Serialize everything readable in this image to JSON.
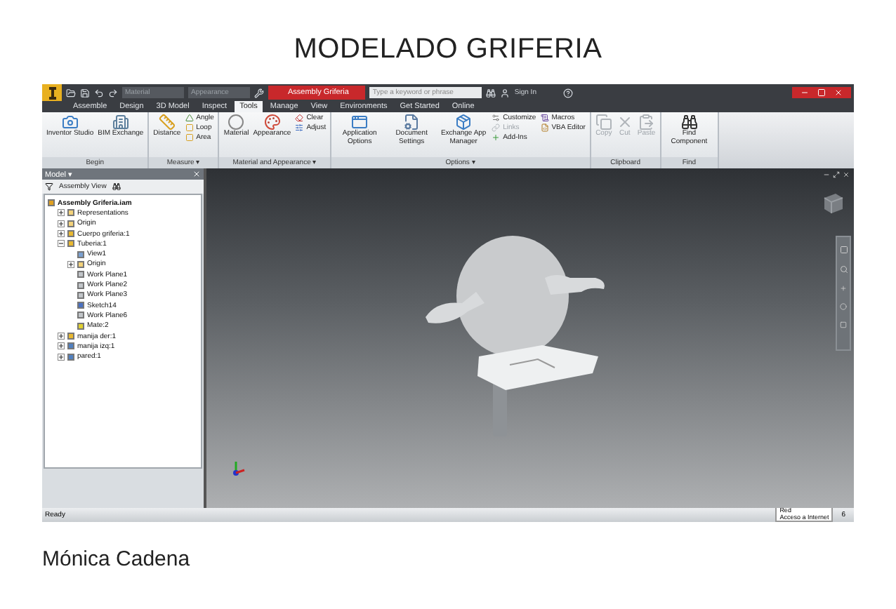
{
  "slide": {
    "title": "MODELADO GRIFERIA",
    "author": "Mónica Cadena"
  },
  "title_bar": {
    "material_field": "Material",
    "appearance_field": "Appearance",
    "document_tab": "Assembly Griferia",
    "search": {
      "placeholder": "Type a keyword or phrase"
    },
    "sign_in": "Sign In"
  },
  "tabs": [
    {
      "label": "Assemble",
      "selected": false
    },
    {
      "label": "Design",
      "selected": false
    },
    {
      "label": "3D Model",
      "selected": false
    },
    {
      "label": "Inspect",
      "selected": false
    },
    {
      "label": "Tools",
      "selected": true
    },
    {
      "label": "Manage",
      "selected": false
    },
    {
      "label": "View",
      "selected": false
    },
    {
      "label": "Environments",
      "selected": false
    },
    {
      "label": "Get Started",
      "selected": false
    },
    {
      "label": "Online",
      "selected": false
    }
  ],
  "ribbon": [
    {
      "label": "Begin",
      "tools": [
        {
          "label": "Inventor Studio",
          "kind": "large",
          "disabled": false
        },
        {
          "label": "BIM Exchange",
          "kind": "large",
          "disabled": false
        }
      ]
    },
    {
      "label": "Measure ▾",
      "tools": [
        {
          "label": "Distance",
          "kind": "large",
          "disabled": false
        },
        {
          "label": "Angle",
          "kind": "small",
          "disabled": false
        },
        {
          "label": "Loop",
          "kind": "small",
          "disabled": false
        },
        {
          "label": "Area",
          "kind": "small",
          "disabled": false
        }
      ]
    },
    {
      "label": "Material and Appearance ▾",
      "tools": [
        {
          "label": "Material",
          "kind": "large",
          "disabled": false
        },
        {
          "label": "Appearance",
          "kind": "large",
          "disabled": false
        },
        {
          "label": "Clear",
          "kind": "small",
          "disabled": false
        },
        {
          "label": "Adjust",
          "kind": "small",
          "disabled": false
        }
      ]
    },
    {
      "label": "Options ▾",
      "tools": [
        {
          "label": "Application Options",
          "kind": "large",
          "disabled": false
        },
        {
          "label": "Document Settings",
          "kind": "large",
          "disabled": false
        },
        {
          "label": "Exchange App Manager",
          "kind": "large",
          "disabled": false
        },
        {
          "label": "Customize",
          "kind": "small",
          "disabled": false
        },
        {
          "label": "Links",
          "kind": "small",
          "disabled": true
        },
        {
          "label": "Add-Ins",
          "kind": "small",
          "disabled": false
        },
        {
          "label": "Macros",
          "kind": "small",
          "disabled": false
        },
        {
          "label": "VBA Editor",
          "kind": "small",
          "disabled": false
        }
      ]
    },
    {
      "label": "Clipboard",
      "tools": [
        {
          "label": "Copy",
          "kind": "large",
          "disabled": true
        },
        {
          "label": "Cut",
          "kind": "large",
          "disabled": true
        },
        {
          "label": "Paste",
          "kind": "large",
          "disabled": true
        }
      ]
    },
    {
      "label": "Find",
      "tools": [
        {
          "label": "Find Component",
          "kind": "large",
          "disabled": false
        }
      ]
    }
  ],
  "browser": {
    "title": "Model ▾",
    "view": "Assembly View",
    "tree": [
      {
        "label": "Assembly Griferia.iam",
        "kind": "assembly",
        "children": [
          {
            "label": "Representations",
            "kind": "folder",
            "expanded": false
          },
          {
            "label": "Origin",
            "kind": "folder",
            "expanded": false
          },
          {
            "label": "Cuerpo griferia:1",
            "kind": "part",
            "expanded": false
          },
          {
            "label": "Tuberia:1",
            "kind": "part",
            "expanded": true,
            "children": [
              {
                "label": "View1",
                "kind": "view"
              },
              {
                "label": "Origin",
                "kind": "folder",
                "expanded": false
              },
              {
                "label": "Work Plane1",
                "kind": "plane"
              },
              {
                "label": "Work Plane2",
                "kind": "plane"
              },
              {
                "label": "Work Plane3",
                "kind": "plane"
              },
              {
                "label": "Sketch14",
                "kind": "sketch"
              },
              {
                "label": "Work Plane6",
                "kind": "plane"
              },
              {
                "label": "Mate:2",
                "kind": "constraint"
              }
            ]
          },
          {
            "label": "manija der:1",
            "kind": "part",
            "expanded": false
          },
          {
            "label": "manija izq:1",
            "kind": "link",
            "expanded": false
          },
          {
            "label": "pared:1",
            "kind": "link",
            "expanded": false
          }
        ]
      }
    ]
  },
  "status_bar": {
    "text": "Ready",
    "tooltip": [
      "Red",
      "Acceso a Internet"
    ],
    "count": "6"
  }
}
